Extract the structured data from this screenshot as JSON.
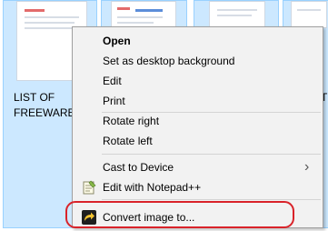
{
  "files": [
    {
      "name_line1": "LIST OF",
      "name_line2": "FREEWARE"
    }
  ],
  "cut_label": "T",
  "menu": {
    "open": "Open",
    "set_background": "Set as desktop background",
    "edit": "Edit",
    "print": "Print",
    "rotate_right": "Rotate right",
    "rotate_left": "Rotate left",
    "cast": "Cast to Device",
    "cast_chevron": "›",
    "edit_notepad": "Edit with Notepad++",
    "convert": "Convert image to..."
  },
  "colors": {
    "selection_fill": "#cce8ff",
    "selection_border": "#99d1ff",
    "menu_bg": "#f2f2f2",
    "highlight_ring": "#d9232a"
  },
  "icons": {
    "notepad": "notepad-plus-plus-icon",
    "convert": "convert-arrow-icon"
  }
}
